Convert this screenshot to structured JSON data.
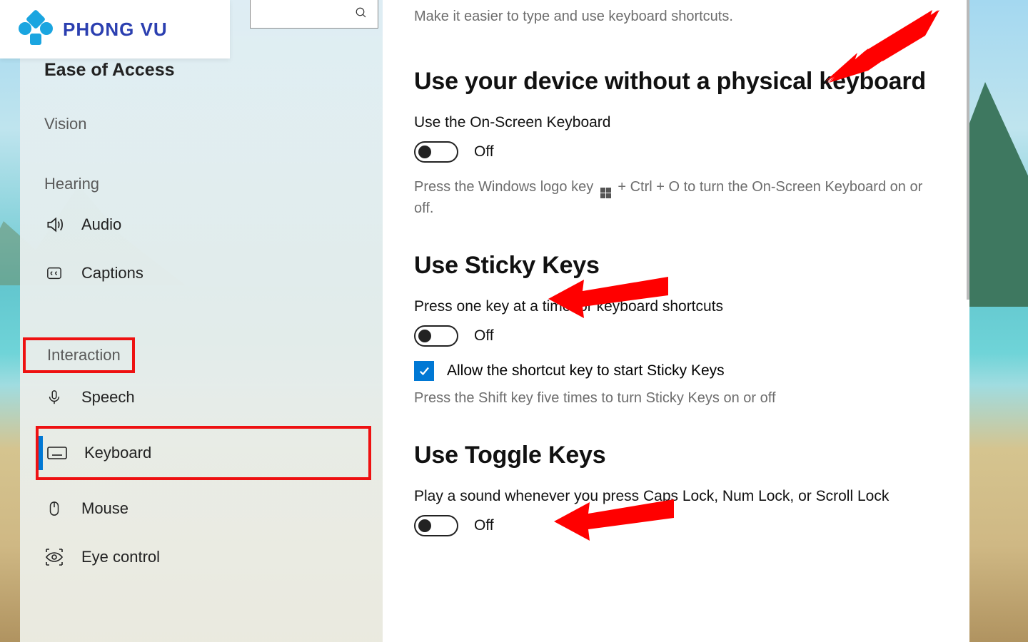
{
  "logo": {
    "text": "PHONG VU"
  },
  "sidebar": {
    "page_title": "Ease of Access",
    "groups": [
      {
        "label": "Vision",
        "items": []
      },
      {
        "label": "Hearing",
        "items": [
          {
            "key": "audio",
            "label": "Audio",
            "icon": "speaker"
          },
          {
            "key": "captions",
            "label": "Captions",
            "icon": "cc"
          }
        ]
      },
      {
        "label": "Interaction",
        "items": [
          {
            "key": "speech",
            "label": "Speech",
            "icon": "mic"
          },
          {
            "key": "keyboard",
            "label": "Keyboard",
            "icon": "keyboard",
            "selected": true
          },
          {
            "key": "mouse",
            "label": "Mouse",
            "icon": "mouse"
          },
          {
            "key": "eyecontrol",
            "label": "Eye control",
            "icon": "eye"
          }
        ]
      }
    ]
  },
  "content": {
    "intro": "Make it easier to type and use keyboard shortcuts.",
    "section1": {
      "heading": "Use your device without a physical keyboard",
      "label": "Use the On-Screen Keyboard",
      "toggle_state": "Off",
      "hint_before": "Press the Windows logo key ",
      "hint_after": " + Ctrl + O to turn the On-Screen Keyboard on or off."
    },
    "section2": {
      "heading": "Use Sticky Keys",
      "label": "Press one key at a time for keyboard shortcuts",
      "toggle_state": "Off",
      "checkbox_label": "Allow the shortcut key to start Sticky Keys",
      "hint": "Press the Shift key five times to turn Sticky Keys on or off"
    },
    "section3": {
      "heading": "Use Toggle Keys",
      "label": "Play a sound whenever you press Caps Lock, Num Lock, or Scroll Lock",
      "toggle_state": "Off"
    }
  }
}
